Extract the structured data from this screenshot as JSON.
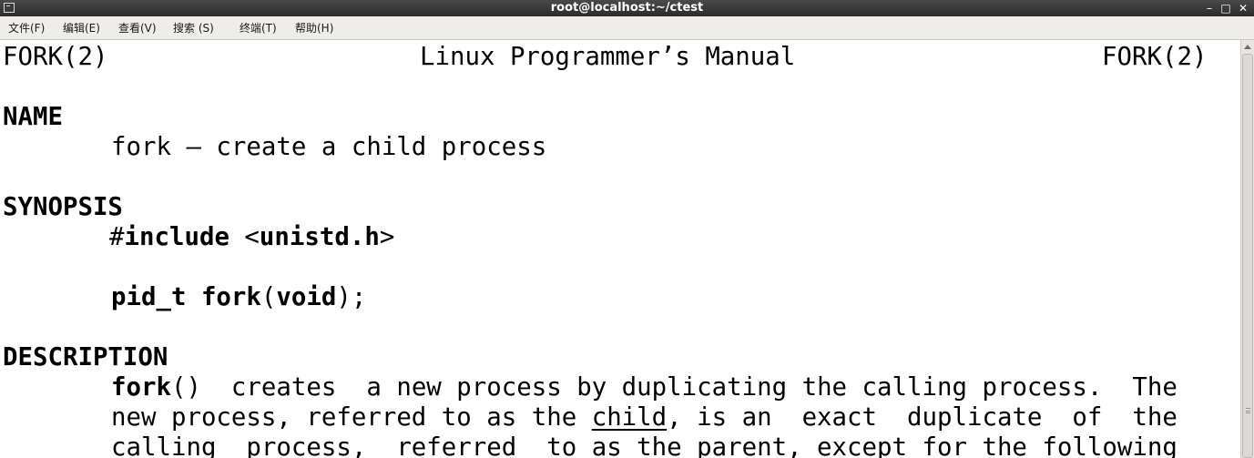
{
  "window": {
    "title": "root@localhost:~/ctest",
    "icon": "terminal-icon",
    "buttons": {
      "minimize": "–",
      "maximize": "□",
      "close": "✕"
    }
  },
  "menubar": {
    "items": [
      "文件(F)",
      "编辑(E)",
      "查看(V)",
      "搜索 (S)",
      "终端(T)",
      "帮助(H)"
    ]
  },
  "man": {
    "header": {
      "left": "FORK(2)",
      "center": "Linux Programmer’s Manual",
      "right": "FORK(2)"
    },
    "name_heading": "NAME",
    "name_text": "fork – create a child process",
    "synopsis_heading": "SYNOPSIS",
    "include_hash": "#",
    "include_kw": "include",
    "include_open": " <",
    "include_file": "unistd.h",
    "include_close": ">",
    "proto_ret": "pid_t fork",
    "proto_open": "(",
    "proto_arg": "void",
    "proto_close": ");",
    "description_heading": "DESCRIPTION",
    "desc1_fn": "fork",
    "desc1_rest": "()  creates  a new process by duplicating the calling process.  The",
    "desc2_a": "new process, referred to as the ",
    "desc2_child": "child",
    "desc2_b": ", is an  exact  duplicate  of  the",
    "desc3": "calling  process,  referred  to as the parent, except for the following"
  }
}
